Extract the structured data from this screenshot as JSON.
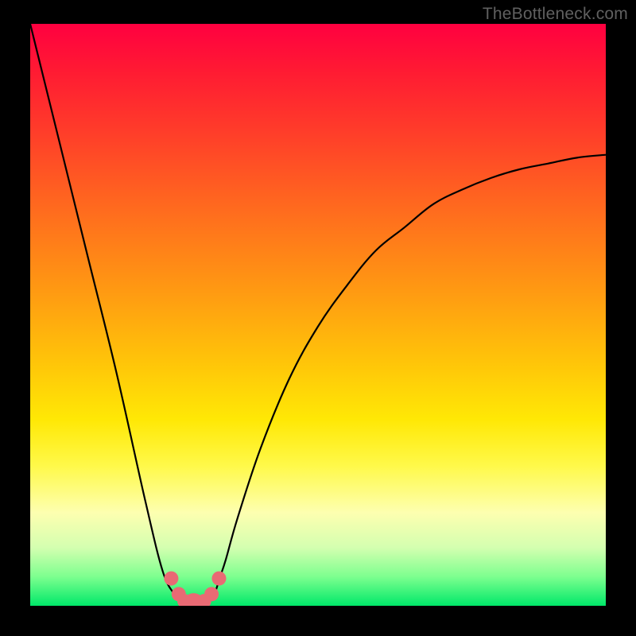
{
  "watermark": "TheBottleneck.com",
  "chart_data": {
    "type": "line",
    "title": "",
    "xlabel": "",
    "ylabel": "",
    "xlim": [
      0,
      100
    ],
    "ylim": [
      0,
      100
    ],
    "series": [
      {
        "name": "bottleneck-curve",
        "x": [
          0,
          5,
          10,
          15,
          20,
          23,
          25,
          26,
          27,
          28,
          29,
          30,
          31,
          32,
          33,
          34,
          36,
          40,
          45,
          50,
          55,
          60,
          65,
          70,
          75,
          80,
          85,
          90,
          95,
          100
        ],
        "y": [
          100,
          80,
          60,
          40,
          18,
          6,
          2,
          0.6,
          0.2,
          0.1,
          0.1,
          0.2,
          0.6,
          2,
          5,
          8,
          15,
          27,
          39,
          48,
          55,
          61,
          65,
          69,
          71.5,
          73.5,
          75,
          76,
          77,
          77.5
        ]
      }
    ],
    "markers": {
      "name": "highlight-points",
      "color": "#e96a74",
      "x": [
        24.5,
        25.8,
        26.8,
        27.6,
        28.4,
        29.2,
        30.2,
        31.5,
        32.8
      ],
      "y": [
        4.7,
        2.0,
        0.8,
        0.35,
        0.25,
        0.35,
        0.8,
        2.0,
        4.7
      ],
      "size": [
        9,
        9,
        9,
        10,
        14,
        10,
        9,
        9,
        9
      ]
    },
    "background_gradient": [
      {
        "stop": 0,
        "color": "#ff0040"
      },
      {
        "stop": 50,
        "color": "#ffb000"
      },
      {
        "stop": 80,
        "color": "#ffff50"
      },
      {
        "stop": 100,
        "color": "#00e869"
      }
    ]
  }
}
